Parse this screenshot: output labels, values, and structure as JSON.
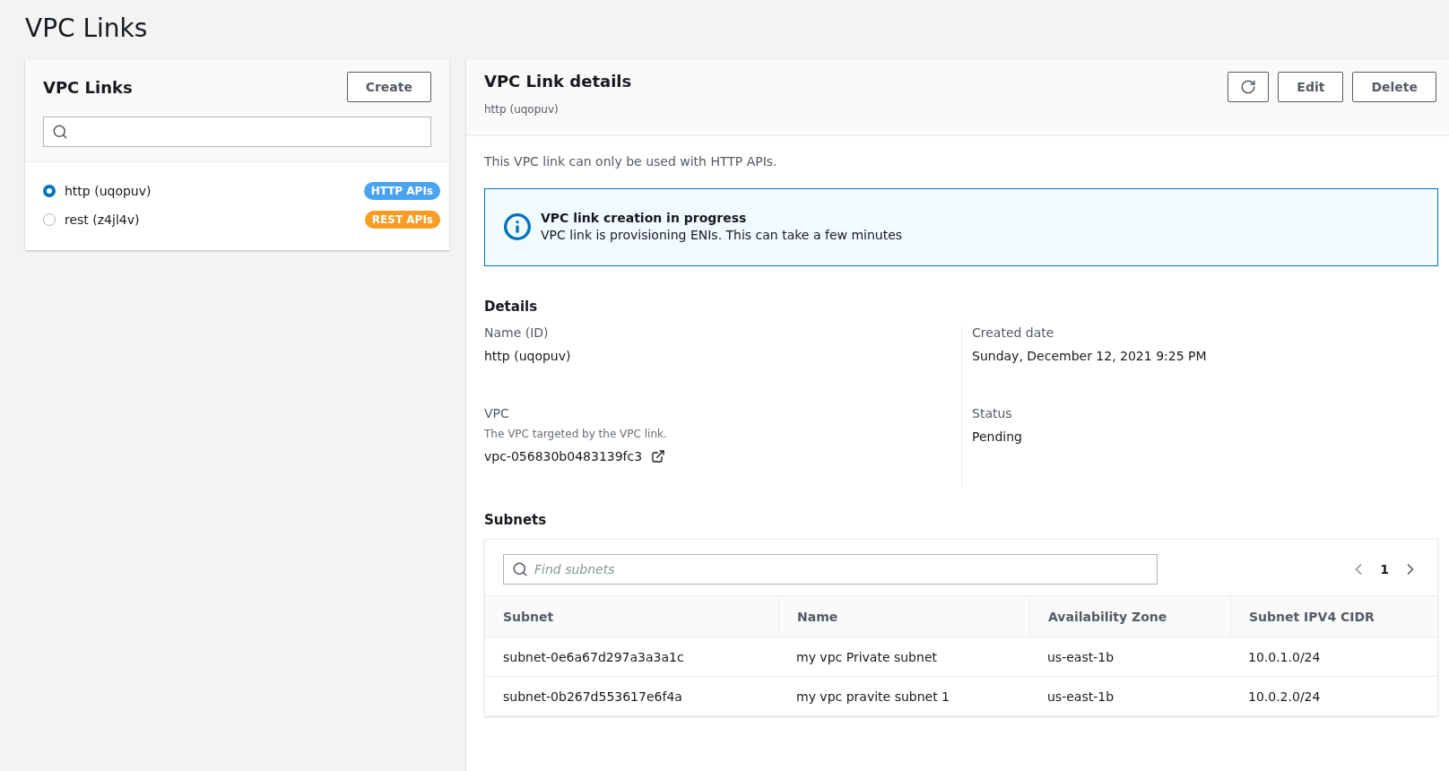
{
  "page_title": "VPC Links",
  "links_panel": {
    "title": "VPC Links",
    "create_button": "Create",
    "items": [
      {
        "label": "http (uqopuv)",
        "selected": true,
        "badge": "HTTP APIs",
        "color": "#4aa3ee"
      },
      {
        "label": "rest (z4jl4v)",
        "selected": false,
        "badge": "REST APIs",
        "color": "#f89c24"
      }
    ]
  },
  "details_panel": {
    "title": "VPC Link details",
    "subtitle": "http (uqopuv)",
    "buttons": [
      "Edit",
      "Delete"
    ],
    "note": "This VPC link can only be used with HTTP APIs.",
    "alert": {
      "title": "VPC link creation in progress",
      "message": "VPC link is provisioning ENIs. This can take a few minutes"
    },
    "details_heading": "Details",
    "left_fields": [
      {
        "label": "Name (ID)",
        "value": "http (uqopuv)"
      },
      {
        "label": "VPC",
        "description": "The VPC targeted by the VPC link.",
        "value": "vpc-056830b0483139fc3",
        "external_link": true
      }
    ],
    "right_fields": [
      {
        "label": "Created date",
        "value": "Sunday, December 12, 2021 9:25 PM"
      },
      {
        "label": "Status",
        "value": "Pending"
      }
    ],
    "subnets": {
      "heading": "Subnets",
      "search": {
        "placeholder": "Find subnets"
      },
      "page": "1",
      "columns": [
        "Subnet",
        "Name",
        "Availability Zone",
        "Subnet IPV4 CIDR"
      ],
      "rows": [
        [
          "subnet-0e6a67d297a3a3a1c",
          "my vpc Private subnet",
          "us-east-1b",
          "10.0.1.0/24"
        ],
        [
          "subnet-0b267d553617e6f4a",
          "my vpc pravite subnet 1",
          "us-east-1b",
          "10.0.2.0/24"
        ]
      ]
    }
  }
}
